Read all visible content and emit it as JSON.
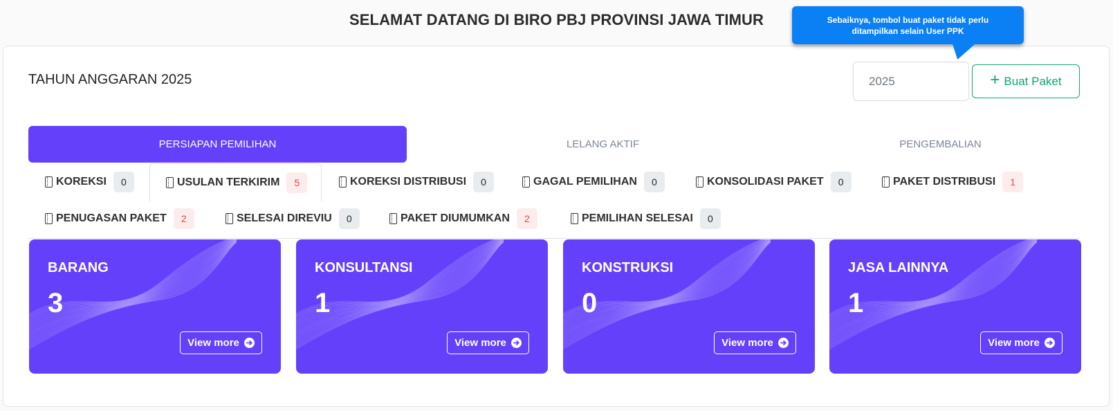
{
  "page_title": "SELAMAT DATANG DI BIRO PBJ PROVINSI JAWA TIMUR",
  "tooltip": "Sebaiknya, tombol buat paket tidak perlu ditampilkan selain User PPK",
  "year_heading": "TAHUN ANGGARAN 2025",
  "year_input": {
    "value": "2025"
  },
  "create_button": {
    "label": "Buat Paket",
    "icon": "plus-icon"
  },
  "main_tabs": [
    {
      "label": "PERSIAPAN PEMILIHAN",
      "active": true
    },
    {
      "label": "LELANG AKTIF",
      "active": false
    },
    {
      "label": "PENGEMBALIAN",
      "active": false
    }
  ],
  "sub_tabs": [
    {
      "label": "KOREKSI",
      "count": "0"
    },
    {
      "label": "USULAN TERKIRIM",
      "count": "5",
      "active": true
    },
    {
      "label": "KOREKSI DISTRIBUSI",
      "count": "0"
    },
    {
      "label": "GAGAL PEMILIHAN",
      "count": "0"
    },
    {
      "label": "KONSOLIDASI PAKET",
      "count": "0"
    },
    {
      "label": "PAKET DISTRIBUSI",
      "count": "1"
    },
    {
      "label": "PENUGASAN PAKET",
      "count": "2"
    },
    {
      "label": "SELESAI DIREVIU",
      "count": "0"
    },
    {
      "label": "PAKET DIUMUMKAN",
      "count": "2"
    },
    {
      "label": "PEMILIHAN SELESAI",
      "count": "0"
    }
  ],
  "categories": [
    {
      "title": "BARANG",
      "count": "3",
      "button": "View more"
    },
    {
      "title": "KONSULTANSI",
      "count": "1",
      "button": "View more"
    },
    {
      "title": "KONSTRUKSI",
      "count": "0",
      "button": "View more"
    },
    {
      "title": "JASA LAINNYA",
      "count": "1",
      "button": "View more"
    }
  ],
  "colors": {
    "accent": "#6440fb",
    "success": "#15a070",
    "tooltip": "#0b80f4",
    "badge_positive": "#e5484d"
  }
}
